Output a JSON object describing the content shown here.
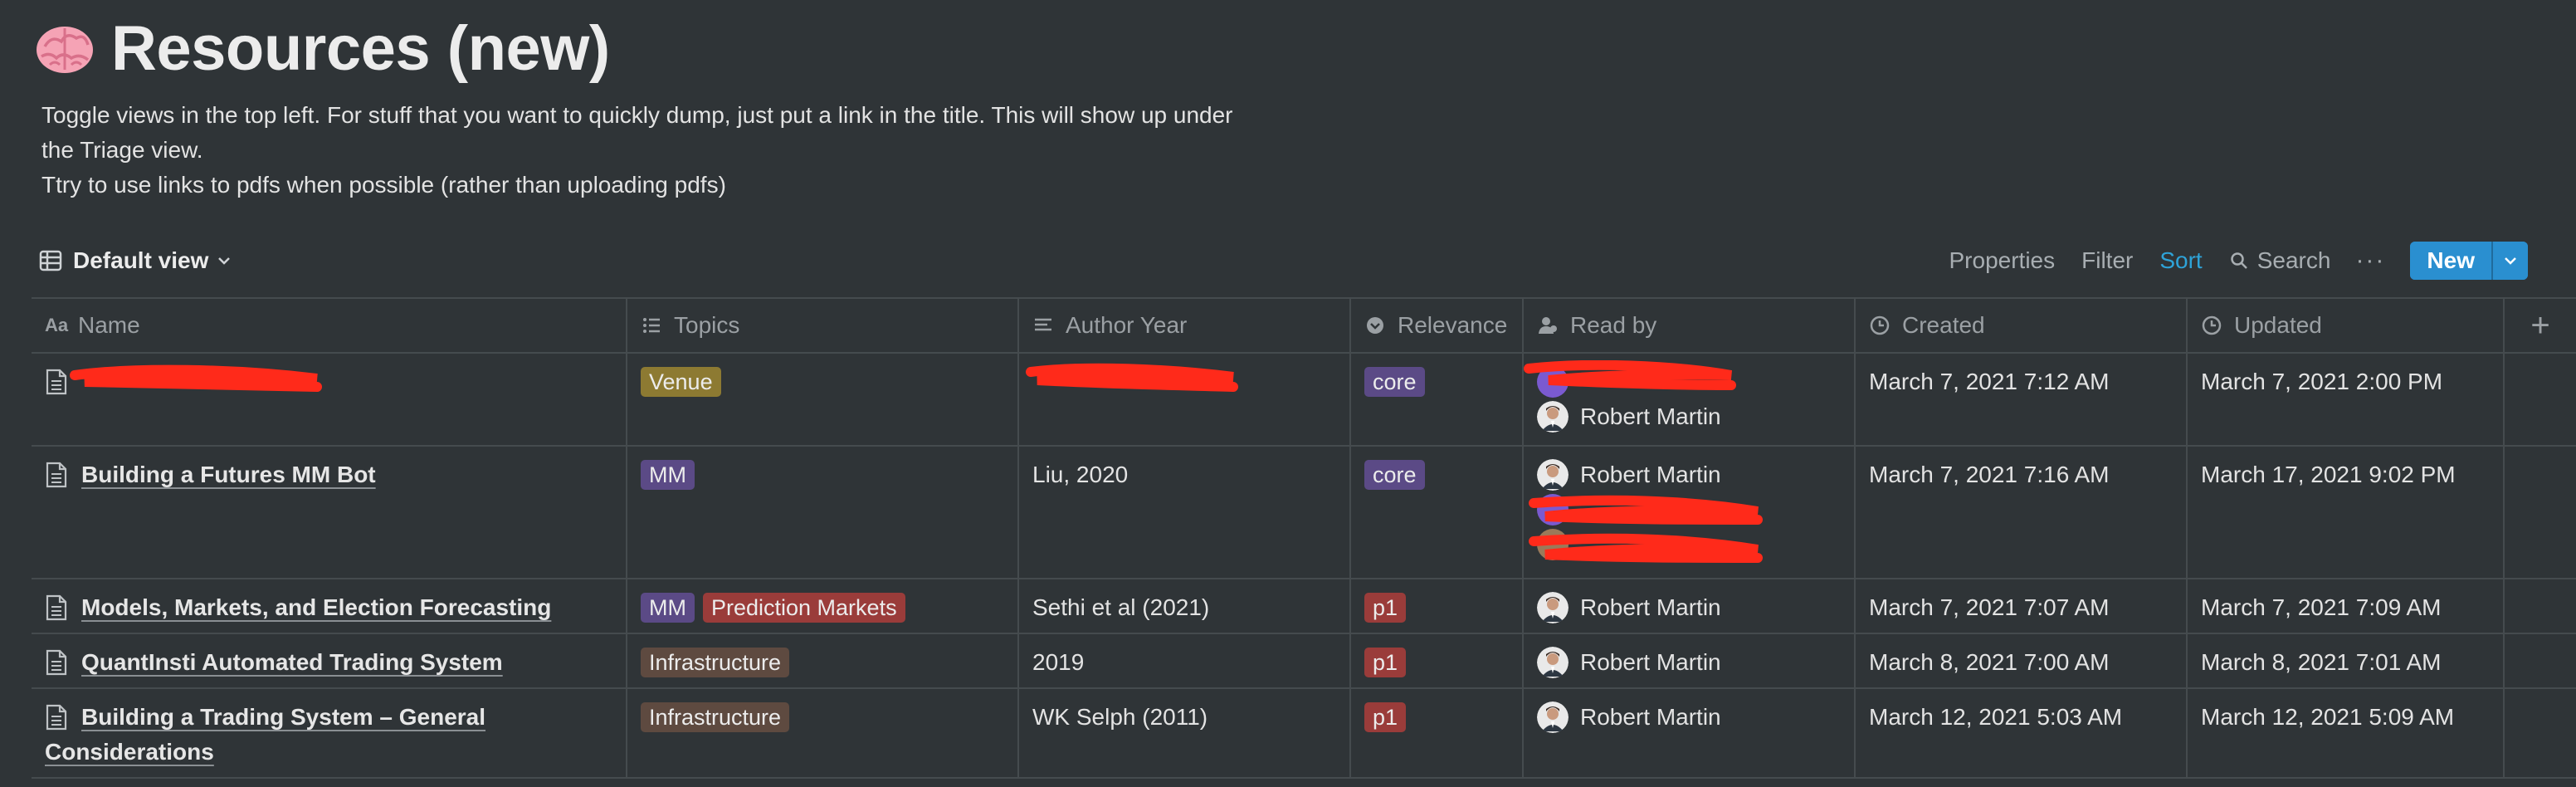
{
  "page": {
    "emoji_icon": "brain-emoji-icon",
    "title": "Resources (new)",
    "description_lines": [
      "Toggle views in the top left. For stuff that you want to quickly dump, just put a link in the title. This will show up under",
      "the Triage view.",
      "Ttry to use links to pdfs when possible (rather than uploading pdfs)"
    ]
  },
  "view": {
    "label": "Default view",
    "icon": "table-icon"
  },
  "toolbar": {
    "properties": "Properties",
    "filter": "Filter",
    "sort": "Sort",
    "search": "Search",
    "more": "···",
    "new": "New"
  },
  "columns": {
    "name": "Name",
    "topics": "Topics",
    "author_year": "Author Year",
    "relevance": "Relevance",
    "read_by": "Read by",
    "created": "Created",
    "updated": "Updated",
    "add": "+"
  },
  "rows": [
    {
      "name": "",
      "topics": [
        "Venue"
      ],
      "author_year": "",
      "relevance": "core",
      "read_by": [
        "",
        "Robert Martin"
      ],
      "created": "March 7, 2021 7:12 AM",
      "updated": "March 7, 2021 2:00 PM"
    },
    {
      "name": "Building a Futures MM Bot",
      "topics": [
        "MM"
      ],
      "author_year": "Liu, 2020",
      "relevance": "core",
      "read_by": [
        "Robert Martin",
        "",
        ""
      ],
      "created": "March 7, 2021 7:16 AM",
      "updated": "March 17, 2021 9:02 PM"
    },
    {
      "name": "Models, Markets, and Election Forecasting",
      "topics": [
        "MM",
        "Prediction Markets"
      ],
      "author_year": "Sethi et al (2021)",
      "relevance": "p1",
      "read_by": [
        "Robert Martin"
      ],
      "created": "March 7, 2021 7:07 AM",
      "updated": "March 7, 2021 7:09 AM"
    },
    {
      "name": "QuantInsti Automated Trading System",
      "topics": [
        "Infrastructure"
      ],
      "author_year": "2019",
      "relevance": "p1",
      "read_by": [
        "Robert Martin"
      ],
      "created": "March 8, 2021 7:00 AM",
      "updated": "March 8, 2021 7:01 AM"
    },
    {
      "name_line1": "Building a Trading System – General",
      "name_line2": "Considerations",
      "topics": [
        "Infrastructure"
      ],
      "author_year": "WK Selph (2011)",
      "relevance": "p1",
      "read_by": [
        "Robert Martin"
      ],
      "created": "March 12, 2021 5:03 AM",
      "updated": "March 12, 2021 5:09 AM"
    }
  ],
  "colors": {
    "background": "#2f3437",
    "accent_blue": "#2a8fd0",
    "redaction_red": "#ff2a1a",
    "tag_venue": "#8d7a32",
    "tag_purple": "#5b4a86",
    "tag_red": "#9a3c3a",
    "tag_brown": "#5e4a40"
  }
}
